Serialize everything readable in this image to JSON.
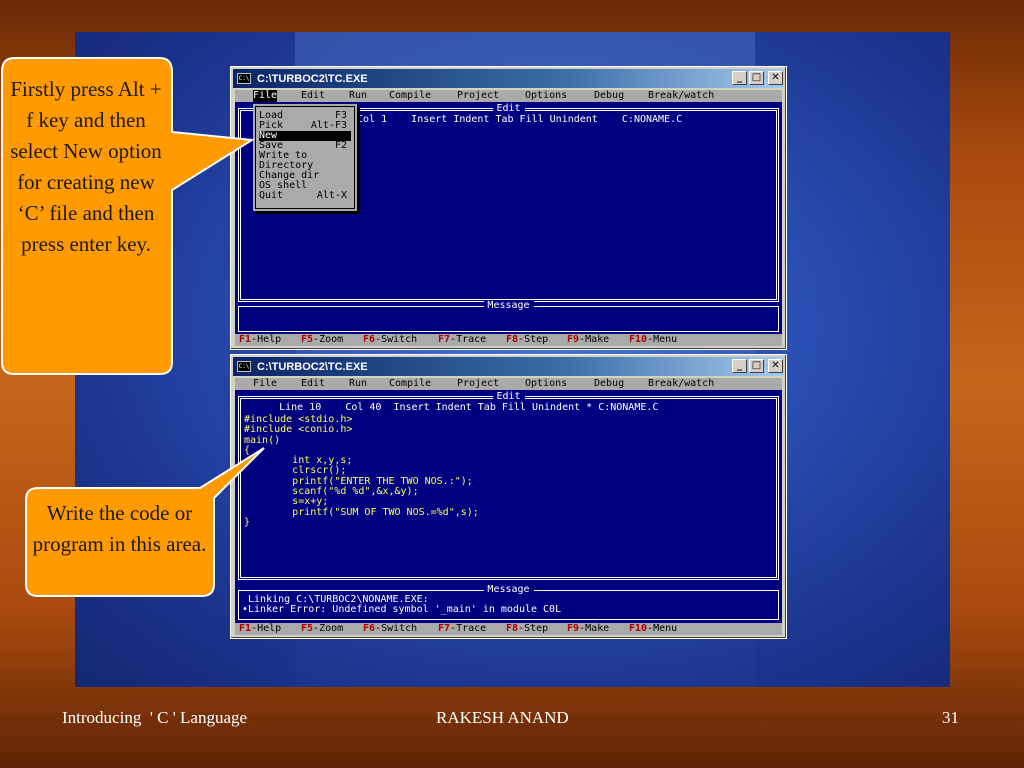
{
  "slide": {
    "footer_left": "Introducing  ' C ' Language",
    "footer_center": "RAKESH ANAND",
    "footer_right": "31",
    "colors": {
      "callout": "#ff9a00",
      "panel": "#2a4fb4",
      "background": "#a84a0e"
    }
  },
  "callouts": {
    "first": "Firstly press Alt + f key and then select New option  for creating new ‘C’ file and then press enter key.",
    "second": "Write the code or program in this area."
  },
  "window1": {
    "title": "C:\\TURBOC2\\TC.EXE",
    "icon": "console-icon",
    "controls": {
      "minimize": "_",
      "maximize": "□",
      "close": "✕"
    },
    "menu": [
      "File",
      "Edit",
      "Run",
      "Compile",
      "Project",
      "Options",
      "Debug",
      "Break/watch"
    ],
    "edit_label": "Edit",
    "status": "Col 1    Insert Indent Tab Fill Unindent    C:NONAME.C",
    "message_label": "Message",
    "file_menu": [
      {
        "label": "Load",
        "accel": "F3"
      },
      {
        "label": "Pick",
        "accel": "Alt-F3"
      },
      {
        "label": "New",
        "accel": ""
      },
      {
        "label": "Save",
        "accel": "F2"
      },
      {
        "label": "Write to",
        "accel": ""
      },
      {
        "label": "Directory",
        "accel": ""
      },
      {
        "label": "Change dir",
        "accel": ""
      },
      {
        "label": "OS shell",
        "accel": ""
      },
      {
        "label": "Quit",
        "accel": "Alt-X"
      }
    ]
  },
  "window2": {
    "title": "C:\\TURBOC2\\TC.EXE",
    "menu": [
      "File",
      "Edit",
      "Run",
      "Compile",
      "Project",
      "Options",
      "Debug",
      "Break/watch"
    ],
    "edit_label": "Edit",
    "status": "     Line 10    Col 40  Insert Indent Tab Fill Unindent * C:NONAME.C",
    "code": "#include <stdio.h>\n#include <conio.h>\nmain()\n{\n\tint x,y,s;\n\tclrscr();\n\tprintf(\"ENTER THE TWO NOS.:\");\n\tscanf(\"%d %d\",&x,&y);\n\ts=x+y;\n\tprintf(\"SUM OF TWO NOS.=%d\",s);\n}",
    "message_label": "Message",
    "messages": " Linking C:\\TURBOC2\\NONAME.EXE:\n•Linker Error: Undefined symbol '_main' in module C0L"
  },
  "fkeys": [
    {
      "key": "F1",
      "label": "-Help"
    },
    {
      "key": "F5",
      "label": "-Zoom"
    },
    {
      "key": "F6",
      "label": "-Switch"
    },
    {
      "key": "F7",
      "label": "-Trace"
    },
    {
      "key": "F8",
      "label": "-Step"
    },
    {
      "key": "F9",
      "label": "-Make"
    },
    {
      "key": "F10",
      "label": "-Menu"
    }
  ]
}
